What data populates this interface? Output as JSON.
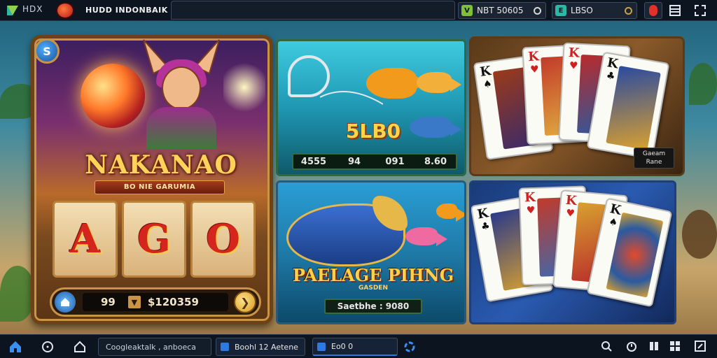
{
  "topbar": {
    "hdr_label": "HDX",
    "title": "HUDD INDONBAIK",
    "coins": [
      {
        "icon": "green-coin-icon",
        "value": "NBT 50605"
      },
      {
        "icon": "teal-coin-icon",
        "value": "LBSO"
      }
    ]
  },
  "slot": {
    "title": "NAKANAO",
    "subtitle": "BO NIE GARUMIA",
    "reels": [
      "A",
      "G",
      "O"
    ],
    "bet": "99",
    "balance": "$120359"
  },
  "fishing": {
    "score": "5LB0",
    "stats": [
      "4555",
      "94",
      "091",
      "8.60"
    ]
  },
  "hunter": {
    "title": "PAELAGE PIHNG",
    "subtitle": "GASDEN",
    "bar": "Saetbhe : 9080"
  },
  "cards_top": {
    "cards": [
      {
        "rank": "K",
        "suit": "♠",
        "color": "black"
      },
      {
        "rank": "K",
        "suit": "♥",
        "color": "red"
      },
      {
        "rank": "K",
        "suit": "♥",
        "color": "red"
      },
      {
        "rank": "K",
        "suit": "♣",
        "color": "black"
      }
    ],
    "label_line1": "Gaeam",
    "label_line2": "Rane"
  },
  "cards_bottom": {
    "cards": [
      {
        "rank": "K",
        "suit": "♣",
        "color": "black"
      },
      {
        "rank": "K",
        "suit": "♥",
        "color": "red"
      },
      {
        "rank": "K",
        "suit": "♥",
        "color": "red"
      },
      {
        "rank": "K",
        "suit": "♠",
        "color": "black"
      }
    ]
  },
  "taskbar": {
    "search_text": "Coogleaktalk , anboeca",
    "tasks": [
      {
        "label": "Boohl  12 Aetene"
      },
      {
        "label": "Eo0   0"
      }
    ]
  }
}
